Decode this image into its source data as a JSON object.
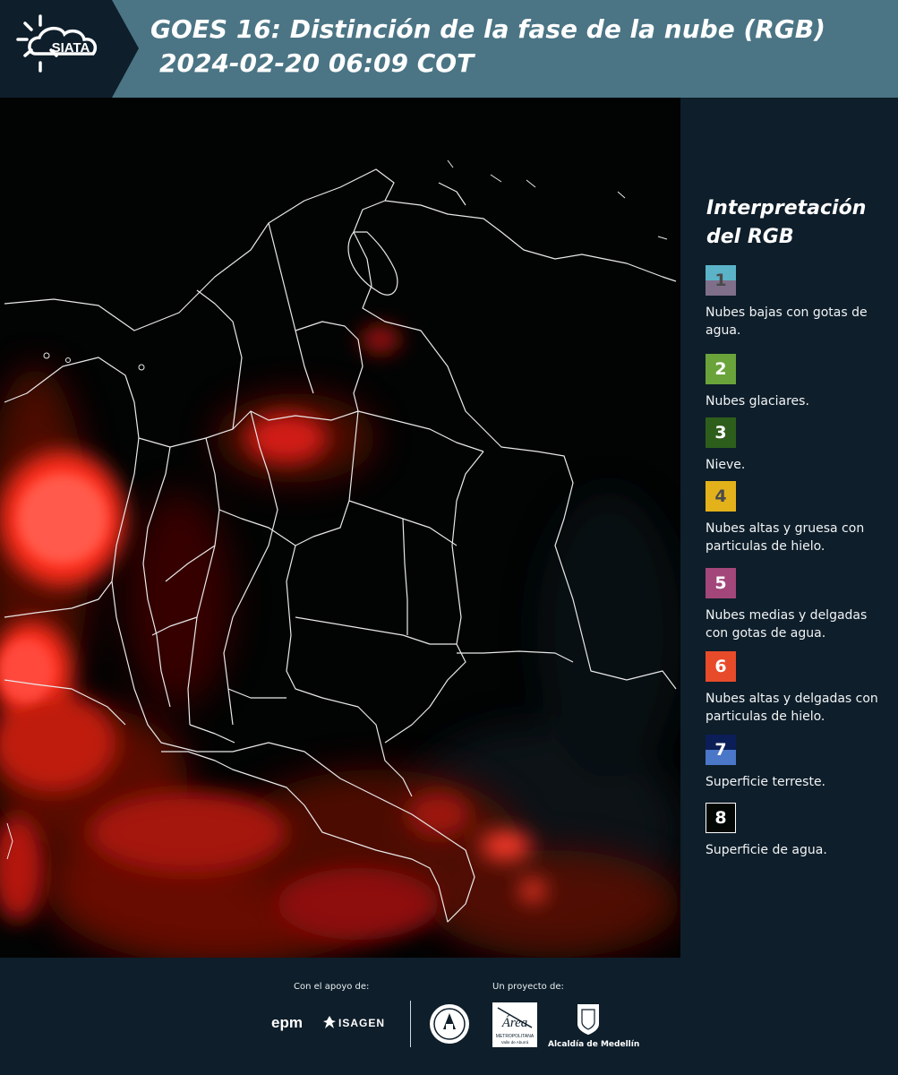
{
  "header": {
    "logo_text": "SIATA",
    "title_line1": "GOES 16: Distinción de la fase de la nube (RGB)",
    "title_line2": "2024-02-20 06:09 COT"
  },
  "legend": {
    "title_line1": "Interpretación",
    "title_line2": "del RGB",
    "items": [
      {
        "num": "1",
        "color_top": "#5bb3c8",
        "color_bottom": "#7f6f8a",
        "text_color": "#4a4a4a",
        "desc": "Nubes bajas con gotas de agua."
      },
      {
        "num": "2",
        "color": "#6aa33a",
        "text_color": "#ffffff",
        "desc": "Nubes glaciares."
      },
      {
        "num": "3",
        "color": "#2e5e1c",
        "text_color": "#ffffff",
        "desc": "Nieve."
      },
      {
        "num": "4",
        "color": "#e3b21b",
        "text_color": "#4a4a4a",
        "desc": "Nubes altas y gruesa con particulas de hielo."
      },
      {
        "num": "5",
        "color": "#a3467a",
        "text_color": "#ffffff",
        "desc": "Nubes medias y delgadas con gotas de agua."
      },
      {
        "num": "6",
        "color": "#e74b2a",
        "text_color": "#ffffff",
        "desc": "Nubes altas y delgadas con particulas de hielo."
      },
      {
        "num": "7",
        "color_top": "#0b1e57",
        "color_bottom": "#4b77c9",
        "text_color": "#ffffff",
        "desc": "Superficie terreste."
      },
      {
        "num": "8",
        "color": "#030805",
        "text_color": "#ffffff",
        "border": "#ffffff",
        "desc": "Superficie de agua."
      }
    ]
  },
  "footer": {
    "support_label": "Con el apoyo de:",
    "project_label": "Un proyecto de:",
    "sponsor_epm": "epm",
    "sponsor_isagen": "ISAGEN",
    "area_name": "Área",
    "area_sub": "METROPOLITANA",
    "area_sub2": "Valle de Aburrá",
    "alcaldia": "Alcaldía de Medellín"
  }
}
